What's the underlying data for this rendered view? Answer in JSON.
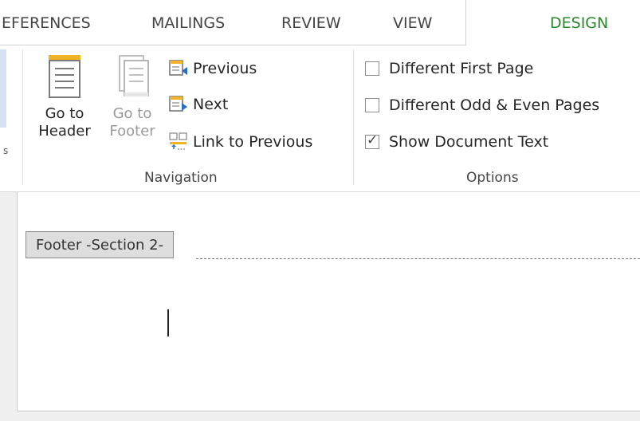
{
  "tabs": [
    "EFERENCES",
    "MAILINGS",
    "REVIEW",
    "VIEW"
  ],
  "active_tab": "DESIGN",
  "navigation": {
    "go_to_header": [
      "Go to",
      "Header"
    ],
    "go_to_footer": [
      "Go to",
      "Footer"
    ],
    "previous": "Previous",
    "next": "Next",
    "link_to_previous": "Link to Previous",
    "group_label": "Navigation"
  },
  "options": {
    "items": [
      {
        "label": "Different First Page",
        "checked": false
      },
      {
        "label": "Different Odd & Even Pages",
        "checked": false
      },
      {
        "label": "Show Document Text",
        "checked": true
      }
    ],
    "group_label": "Options"
  },
  "document": {
    "footer_tag": "Footer -Section 2-"
  },
  "colors": {
    "active_tab": "#2a8a2a",
    "doc_icon_accent": "#f0b429"
  }
}
